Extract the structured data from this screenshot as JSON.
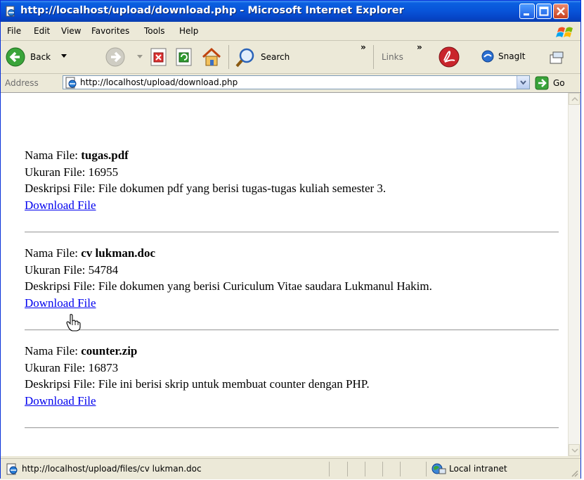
{
  "window": {
    "title": "http://localhost/upload/download.php - Microsoft Internet Explorer"
  },
  "menu": [
    "File",
    "Edit",
    "View",
    "Favorites",
    "Tools",
    "Help"
  ],
  "toolbar": {
    "back_label": "Back",
    "search_label": "Search",
    "links_label": "Links",
    "snagit_label": "SnagIt"
  },
  "address": {
    "label": "Address",
    "url": "http://localhost/upload/download.php",
    "go_label": "Go"
  },
  "files": [
    {
      "name_label": "Nama File: ",
      "name": "tugas.pdf",
      "size_label": "Ukuran File: ",
      "size": "16955",
      "desc_label": "Deskripsi File: ",
      "desc": "File dokumen pdf yang berisi tugas-tugas kuliah semester 3.",
      "link": "Download File"
    },
    {
      "name_label": "Nama File: ",
      "name": "cv lukman.doc",
      "size_label": "Ukuran File: ",
      "size": "54784",
      "desc_label": "Deskripsi File: ",
      "desc": "File dokumen yang berisi Curiculum Vitae saudara Lukmanul Hakim.",
      "link": "Download File"
    },
    {
      "name_label": "Nama File: ",
      "name": "counter.zip",
      "size_label": "Ukuran File: ",
      "size": "16873",
      "desc_label": "Deskripsi File: ",
      "desc": "File ini berisi skrip untuk membuat counter dengan PHP.",
      "link": "Download File"
    }
  ],
  "status": {
    "text": "http://localhost/upload/files/cv lukman.doc",
    "zone": "Local intranet"
  }
}
